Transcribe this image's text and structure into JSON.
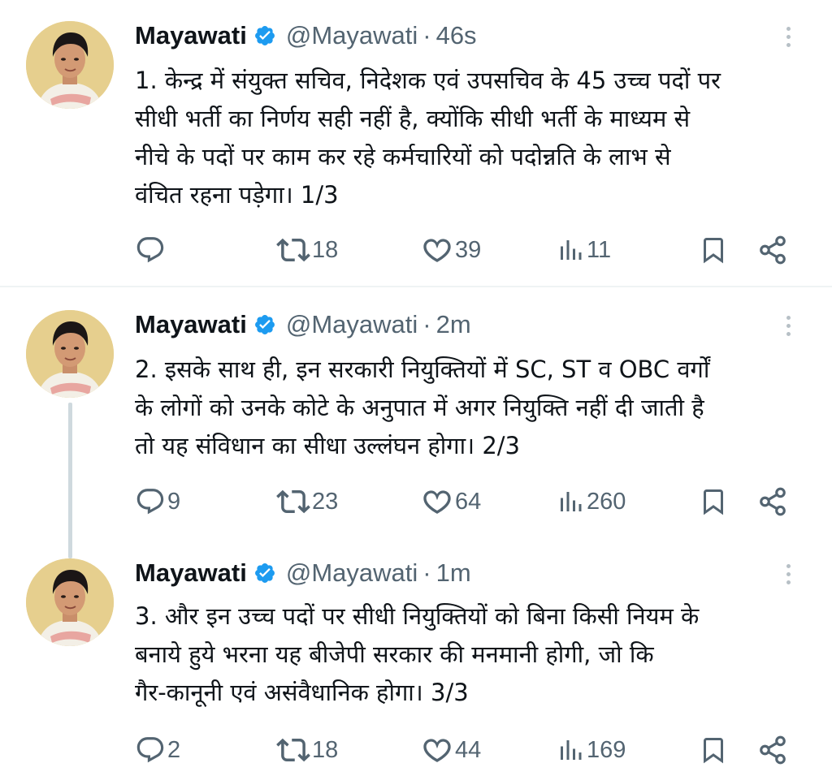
{
  "colors": {
    "accent": "#1d9bf0",
    "muted": "#536471",
    "text": "#0f1419",
    "thread_line": "#cfd9de"
  },
  "tweets": [
    {
      "author": {
        "name": "Mayawati",
        "handle": "@Mayawati",
        "verified_icon": "verified-badge-icon"
      },
      "separator": "·",
      "time": "46s",
      "text_lines": [
        "1. केन्द्र में संयुक्त सचिव, निदेशक एवं उपसचिव के 45 उच्च पदों पर",
        "सीधी भर्ती का निर्णय सही नहीं है, क्योंकि सीधी भर्ती के माध्यम से",
        "नीचे के पदों पर काम कर रहे कर्मचारियों को पदोन्नति के लाभ से",
        "वंचित रहना पड़ेगा। 1/3"
      ],
      "stats": {
        "replies": "",
        "retweets": "18",
        "likes": "39",
        "views": "11"
      }
    },
    {
      "author": {
        "name": "Mayawati",
        "handle": "@Mayawati",
        "verified_icon": "verified-badge-icon"
      },
      "separator": "·",
      "time": "2m",
      "text_lines": [
        "2. इसके साथ ही, इन सरकारी नियुक्तियों में SC, ST व OBC वर्गों",
        "के लोगों को उनके कोटे के अनुपात में अगर नियुक्ति नहीं दी जाती है",
        "तो यह संविधान का सीधा उल्लंघन होगा। 2/3"
      ],
      "stats": {
        "replies": "9",
        "retweets": "23",
        "likes": "64",
        "views": "260"
      }
    },
    {
      "author": {
        "name": "Mayawati",
        "handle": "@Mayawati",
        "verified_icon": "verified-badge-icon"
      },
      "separator": "·",
      "time": "1m",
      "text_lines": [
        "3. और इन उच्च पदों पर सीधी नियुक्तियों को बिना किसी नियम के",
        "बनाये हुये भरना यह बीजेपी सरकार की मनमानी होगी, जो कि",
        "गैर-कानूनी एवं असंवैधानिक होगा। 3/3"
      ],
      "stats": {
        "replies": "2",
        "retweets": "18",
        "likes": "44",
        "views": "169"
      }
    }
  ]
}
